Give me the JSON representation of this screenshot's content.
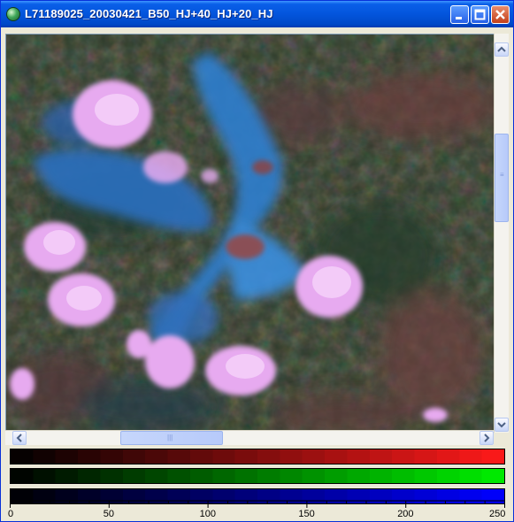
{
  "window": {
    "title": "L71189025_20030421_B50_HJ+40_HJ+20_HJ",
    "buttons": {
      "minimize": "minimize",
      "maximize": "maximize",
      "close": "close"
    }
  },
  "color_bars": [
    {
      "name": "red-channel",
      "color_start": "#000000",
      "color_end": "#ff1a1a"
    },
    {
      "name": "green-channel",
      "color_start": "#000000",
      "color_end": "#00ee00"
    },
    {
      "name": "blue-channel",
      "color_start": "#000000",
      "color_end": "#0000ff"
    }
  ],
  "axis": {
    "ticks": [
      "0",
      "50",
      "100",
      "150",
      "200",
      "250"
    ]
  },
  "scrollbars": {
    "vertical_position": 0.25,
    "horizontal_position": 0.22
  }
}
